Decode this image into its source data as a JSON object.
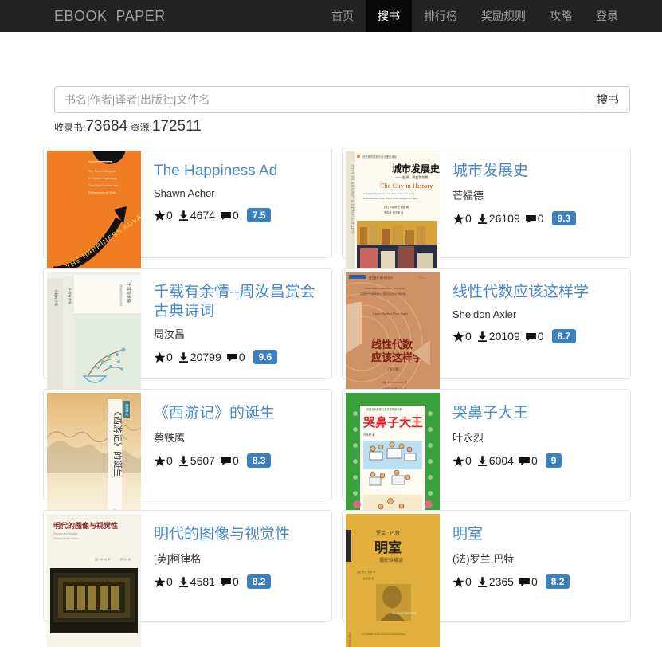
{
  "navbar": {
    "brand": "EBOOK  PAPER",
    "links": [
      {
        "label": "首页",
        "active": false
      },
      {
        "label": "搜书",
        "active": true
      },
      {
        "label": "排行榜",
        "active": false
      },
      {
        "label": "奖励规则",
        "active": false
      },
      {
        "label": "攻略",
        "active": false
      },
      {
        "label": "登录",
        "active": false
      }
    ]
  },
  "search": {
    "placeholder": "书名|作者|译者|出版社|文件名",
    "value": "",
    "button_label": "搜书"
  },
  "stats": {
    "books_label": "收录书:",
    "books_count": "73684",
    "resources_label": " 资源:",
    "resources_count": "172511"
  },
  "colors": {
    "navbar_bg": "#222222",
    "navbar_active_bg": "#080808",
    "title_link": "#4a88c7",
    "badge_bg": "#3c80c2",
    "card_border": "#e3e3e3"
  },
  "icons": {
    "star": "star-icon",
    "download": "download-icon",
    "comment": "comment-icon"
  },
  "books": [
    {
      "title": "The Happiness Ad",
      "author": "Shawn Achor",
      "stars": "0",
      "downloads": "4674",
      "comments": "0",
      "rating": "7.5",
      "cover": "happiness-advantage"
    },
    {
      "title": "城市发展史",
      "author": "芒福德",
      "stars": "0",
      "downloads": "26109",
      "comments": "0",
      "rating": "9.3",
      "cover": "city-in-history"
    },
    {
      "title": "千载有余情--周汝昌赏会古典诗词",
      "author": "周汝昌",
      "stars": "0",
      "downloads": "20799",
      "comments": "0",
      "rating": "9.6",
      "cover": "qianzai-youyuqing"
    },
    {
      "title": "线性代数应该这样学",
      "author": "Sheldon Axler",
      "stars": "0",
      "downloads": "20109",
      "comments": "0",
      "rating": "8.7",
      "cover": "linear-algebra"
    },
    {
      "title": "《西游记》的诞生",
      "author": "蔡铁鹰",
      "stars": "0",
      "downloads": "5607",
      "comments": "0",
      "rating": "8.3",
      "cover": "xiyouji-birth"
    },
    {
      "title": "哭鼻子大王",
      "author": "叶永烈",
      "stars": "0",
      "downloads": "6004",
      "comments": "0",
      "rating": "9",
      "cover": "kubizi-dawang"
    },
    {
      "title": "明代的图像与视觉性",
      "author": "[英]柯律格",
      "stars": "0",
      "downloads": "4581",
      "comments": "0",
      "rating": "8.2",
      "cover": "ming-images"
    },
    {
      "title": "明室",
      "author": "(法)罗兰.巴特",
      "stars": "0",
      "downloads": "2365",
      "comments": "0",
      "rating": "8.2",
      "cover": "camera-lucida"
    }
  ]
}
